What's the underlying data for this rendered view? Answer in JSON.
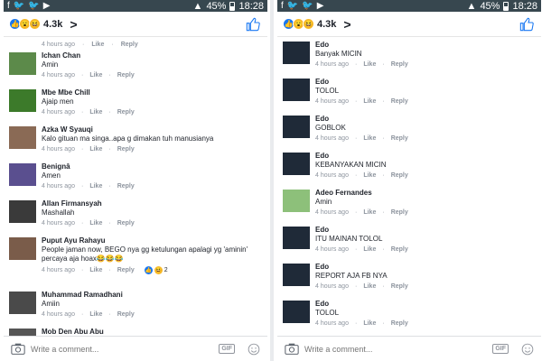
{
  "status": {
    "battery": "45%",
    "time": "18:28"
  },
  "header": {
    "reaction_count": "4.3k"
  },
  "left": {
    "top_meta": {
      "time": "4 hours ago",
      "like": "Like",
      "reply": "Reply"
    },
    "comments": [
      {
        "name": "Ichan Chan",
        "text": "Amin",
        "time": "4 hours ago",
        "like": "Like",
        "reply": "Reply",
        "color": "#5c8a4a"
      },
      {
        "name": "Mbe Mbe Chill",
        "text": "Ajaip men",
        "time": "4 hours ago",
        "like": "Like",
        "reply": "Reply",
        "color": "#3c7a2a"
      },
      {
        "name": "Azka W Syauqi",
        "text": "Kalo gituan ma singa..apa g dimakan tuh manusianya",
        "time": "4 hours ago",
        "like": "Like",
        "reply": "Reply",
        "color": "#8a6a55"
      },
      {
        "name": "Benignâ",
        "text": "Amen",
        "time": "4 hours ago",
        "like": "Like",
        "reply": "Reply",
        "color": "#5a4f8f"
      },
      {
        "name": "Allan Firmansyah",
        "text": "Mashallah",
        "time": "4 hours ago",
        "like": "Like",
        "reply": "Reply",
        "color": "#3a3a3a"
      },
      {
        "name": "Puput Ayu Rahayu",
        "text": "People jaman now, BEGO nya gg ketulungan apalagi yg 'aminin' percaya aja hoax😂😂😂",
        "time": "4 hours ago",
        "like": "Like",
        "reply": "Reply",
        "reactions": "2",
        "color": "#7a5c4a"
      },
      {
        "name": "Muhammad Ramadhani",
        "text": "Amiin",
        "time": "4 hours ago",
        "like": "Like",
        "reply": "Reply",
        "color": "#4a4a4a"
      },
      {
        "name": "Mob Den Abu Abu",
        "text": "",
        "time": "",
        "like": "",
        "reply": "",
        "color": "#555555"
      }
    ]
  },
  "right": {
    "comments": [
      {
        "name": "Edo",
        "text": "Banyak MICIN",
        "time": "4 hours ago",
        "like": "Like",
        "reply": "Reply",
        "color": "#1f2a38"
      },
      {
        "name": "Edo",
        "text": "TOLOL",
        "time": "4 hours ago",
        "like": "Like",
        "reply": "Reply",
        "color": "#1f2a38"
      },
      {
        "name": "Edo",
        "text": "GOBLOK",
        "time": "4 hours ago",
        "like": "Like",
        "reply": "Reply",
        "color": "#1f2a38"
      },
      {
        "name": "Edo",
        "text": "KEBANYAKAN MICIN",
        "time": "4 hours ago",
        "like": "Like",
        "reply": "Reply",
        "color": "#1f2a38"
      },
      {
        "name": "Adeo Fernandes",
        "text": "Amin",
        "time": "4 hours ago",
        "like": "Like",
        "reply": "Reply",
        "color": "#8dc07a"
      },
      {
        "name": "Edo",
        "text": "ITU MAINAN TOLOL",
        "time": "4 hours ago",
        "like": "Like",
        "reply": "Reply",
        "color": "#1f2a38"
      },
      {
        "name": "Edo",
        "text": "REPORT AJA FB NYA",
        "time": "4 hours ago",
        "like": "Like",
        "reply": "Reply",
        "color": "#1f2a38"
      },
      {
        "name": "Edo",
        "text": "TOLOL",
        "time": "4 hours ago",
        "like": "Like",
        "reply": "Reply",
        "color": "#1f2a38"
      }
    ]
  },
  "composer": {
    "placeholder": "Write a comment...",
    "gif_label": "GIF"
  }
}
